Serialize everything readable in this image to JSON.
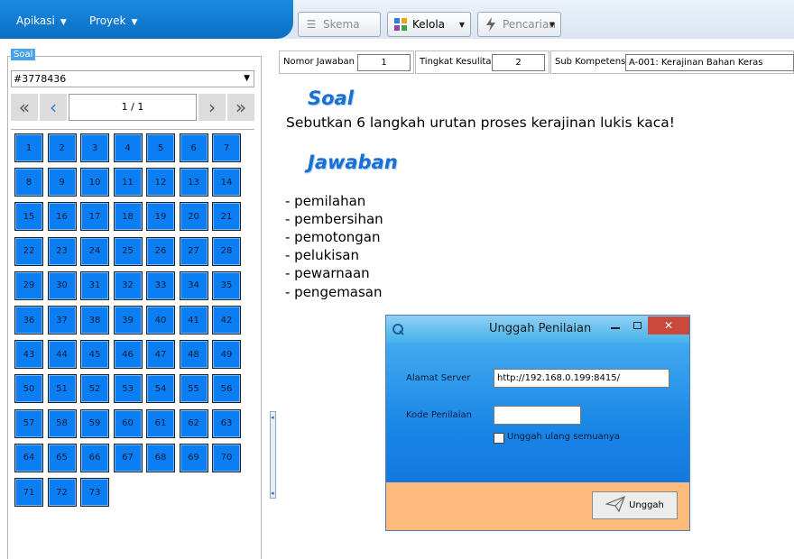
{
  "menu": {
    "items": [
      {
        "label": "Apikasi"
      },
      {
        "label": "Proyek"
      }
    ]
  },
  "toolbar": {
    "skema_label": "Skema",
    "kelola_label": "Kelola",
    "pencarian_label": "Pencarian"
  },
  "left_panel": {
    "title": "Soal",
    "selected_id": "#3778436",
    "page": "1 / 1",
    "numbers": [
      "1",
      "2",
      "3",
      "4",
      "5",
      "6",
      "7",
      "8",
      "9",
      "10",
      "11",
      "12",
      "13",
      "14",
      "15",
      "16",
      "17",
      "18",
      "19",
      "20",
      "21",
      "22",
      "23",
      "24",
      "25",
      "26",
      "27",
      "28",
      "29",
      "30",
      "31",
      "32",
      "33",
      "34",
      "35",
      "36",
      "37",
      "38",
      "39",
      "40",
      "41",
      "42",
      "43",
      "44",
      "45",
      "46",
      "47",
      "48",
      "49",
      "50",
      "51",
      "52",
      "53",
      "54",
      "55",
      "56",
      "57",
      "58",
      "59",
      "60",
      "61",
      "62",
      "63",
      "64",
      "65",
      "66",
      "67",
      "68",
      "69",
      "70",
      "71",
      "72",
      "73"
    ]
  },
  "info": {
    "nomor_label": "Nomor Jawaban",
    "nomor_value": "1",
    "tingkat_label": "Tingkat Kesulitan",
    "tingkat_value": "2",
    "sub_label": "Sub Kompetensi",
    "sub_value": "A-001: Kerajinan Bahan Keras"
  },
  "content": {
    "soal_heading": "Soal",
    "question": "Sebutkan 6 langkah urutan proses kerajinan lukis kaca!",
    "jawaban_heading": "Jawaban",
    "answers": [
      "- pemilahan",
      "- pembersihan",
      "- pemotongan",
      "- pelukisan",
      "- pewarnaan",
      "- pengemasan"
    ]
  },
  "dialog": {
    "title": "Unggah Penilaian",
    "server_label": "Alamat Server",
    "server_value": "http://192.168.0.199:8415/",
    "kode_label": "Kode Penilaian",
    "kode_value": "",
    "checkbox_label": "Unggah ulang semuanya",
    "checkbox_checked": false,
    "button_label": "Unggah"
  }
}
